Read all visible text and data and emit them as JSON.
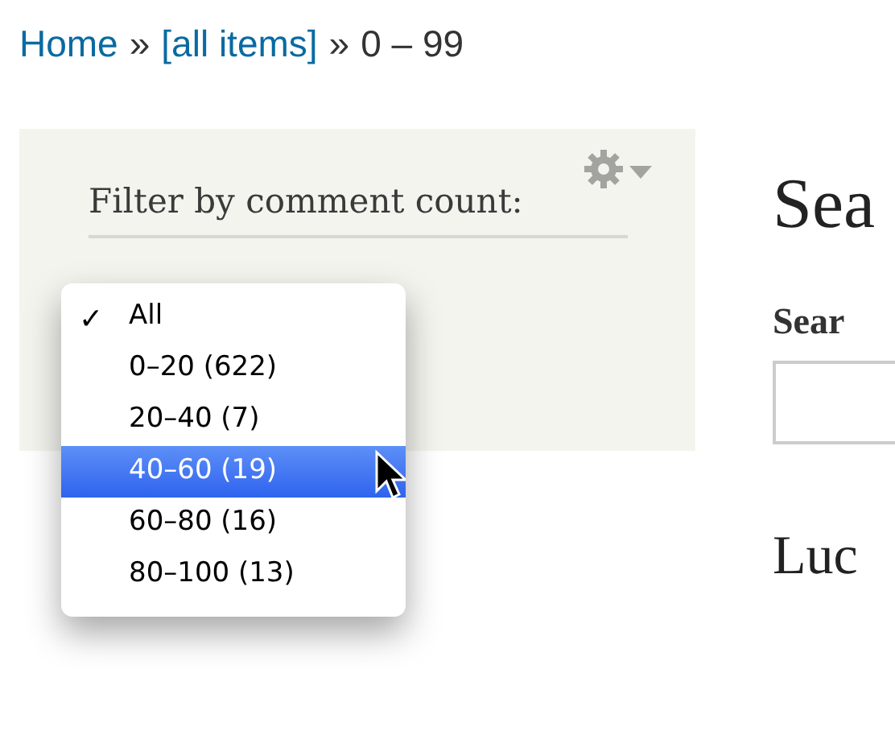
{
  "breadcrumb": [
    {
      "label": "Home",
      "kind": "link"
    },
    {
      "label": "»",
      "kind": "separator"
    },
    {
      "label": "[all items]",
      "kind": "link"
    },
    {
      "label": "»",
      "kind": "separator"
    },
    {
      "label": "0 – 99",
      "kind": "text"
    }
  ],
  "filter_block": {
    "title": "Filter by comment count:",
    "menu": [
      {
        "label": "All",
        "checked": true,
        "selected": false
      },
      {
        "label": "0–20 (622)",
        "checked": false,
        "selected": false
      },
      {
        "label": "20–40 (7)",
        "checked": false,
        "selected": false
      },
      {
        "label": "40–60 (19)",
        "checked": false,
        "selected": true
      },
      {
        "label": "60–80 (16)",
        "checked": false,
        "selected": false
      },
      {
        "label": "80–100 (13)",
        "checked": false,
        "selected": false
      }
    ],
    "check_mark": "✓"
  },
  "main": {
    "heading": "Sea",
    "field_label": "Sear",
    "subheading": "Luc"
  }
}
